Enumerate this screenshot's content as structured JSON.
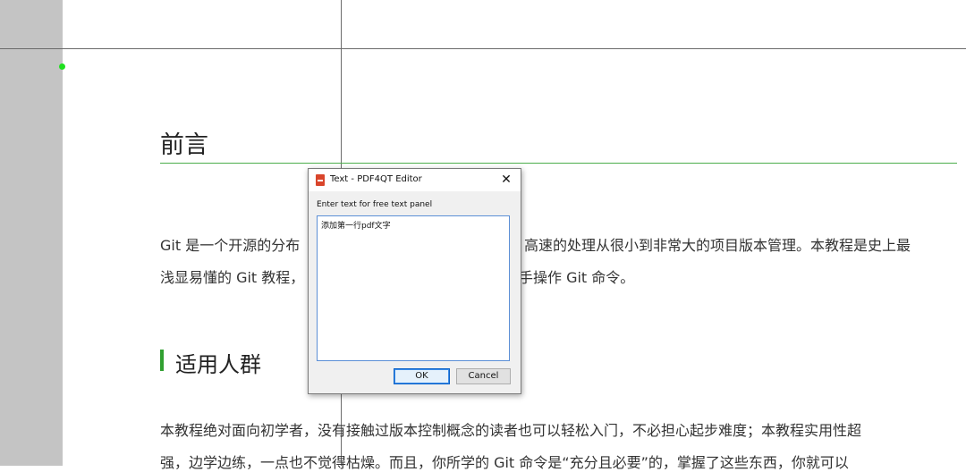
{
  "document": {
    "heading": "前言",
    "paragraph1_line1_left": "Git 是一个开源的分布",
    "paragraph1_line1_right": "高速的处理从很小到非常大的项目版本管理。本教程是史上最",
    "paragraph1_line2_left": "浅显易懂的 Git 教程，",
    "paragraph1_line2_right": "手操作 Git 命令。",
    "section_title": "适用人群",
    "paragraph2_line1": "本教程绝对面向初学者，没有接触过版本控制概念的读者也可以轻松入门，不必担心起步难度；本教程实用性超",
    "paragraph2_line2": "强，边学边练，一点也不觉得枯燥。而且，你所学的 Git 命令是“充分且必要”的，掌握了这些东西，你就可以"
  },
  "dialog": {
    "title": "Text - PDF4QT Editor",
    "close_icon": "close-icon",
    "prompt": "Enter text for free text panel",
    "text_value": "添加第一行pdf文字",
    "ok_label": "OK",
    "cancel_label": "Cancel"
  },
  "colors": {
    "accent_green": "#4cae4c",
    "gutter": "#c4c4c4",
    "ok_border": "#0a62c9"
  }
}
